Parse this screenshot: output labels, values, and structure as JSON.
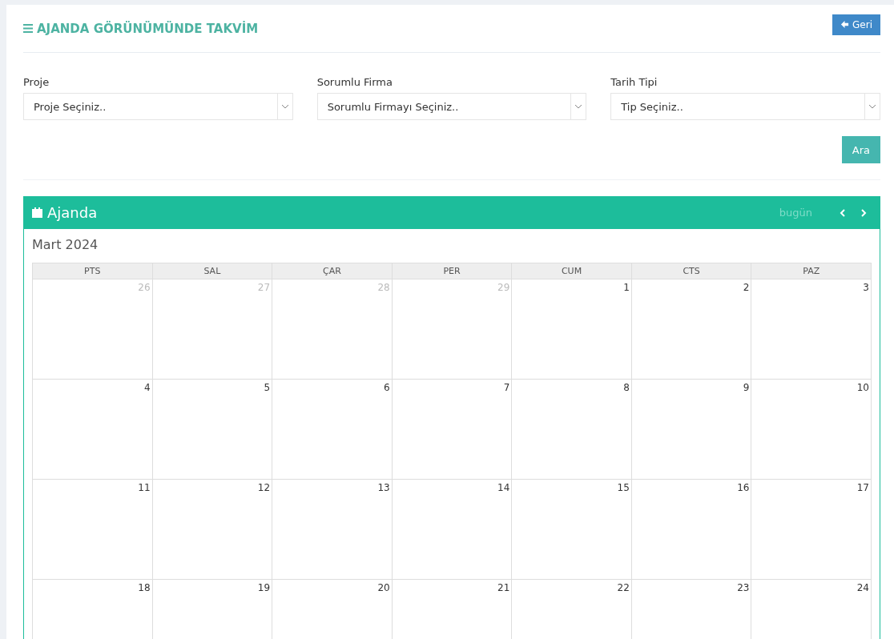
{
  "page_title": "AJANDA GÖRÜNÜMÜNDE TAKVİM",
  "back_button": "Geri",
  "filters": [
    {
      "label": "Proje",
      "placeholder": "Proje Seçiniz.."
    },
    {
      "label": "Sorumlu Firma",
      "placeholder": "Sorumlu Firmayı Seçiniz.."
    },
    {
      "label": "Tarih Tipi",
      "placeholder": "Tip Seçiniz.."
    }
  ],
  "search_button": "Ara",
  "calendar": {
    "panel_title": "Ajanda",
    "today_button": {
      "label": "bugün",
      "disabled": true
    },
    "month": "Mart 2024",
    "weekdays": [
      "PTS",
      "SAL",
      "ÇAR",
      "PER",
      "CUM",
      "CTS",
      "PAZ"
    ],
    "weeks": [
      [
        {
          "day": "26",
          "other_month": true
        },
        {
          "day": "27",
          "other_month": true
        },
        {
          "day": "28",
          "other_month": true
        },
        {
          "day": "29",
          "other_month": true
        },
        {
          "day": "1",
          "other_month": false
        },
        {
          "day": "2",
          "other_month": false
        },
        {
          "day": "3",
          "other_month": false
        }
      ],
      [
        {
          "day": "4",
          "other_month": false
        },
        {
          "day": "5",
          "other_month": false
        },
        {
          "day": "6",
          "other_month": false
        },
        {
          "day": "7",
          "other_month": false
        },
        {
          "day": "8",
          "other_month": false
        },
        {
          "day": "9",
          "other_month": false
        },
        {
          "day": "10",
          "other_month": false
        }
      ],
      [
        {
          "day": "11",
          "other_month": false
        },
        {
          "day": "12",
          "other_month": false
        },
        {
          "day": "13",
          "other_month": false
        },
        {
          "day": "14",
          "other_month": false
        },
        {
          "day": "15",
          "other_month": false
        },
        {
          "day": "16",
          "other_month": false
        },
        {
          "day": "17",
          "other_month": false
        }
      ],
      [
        {
          "day": "18",
          "other_month": false
        },
        {
          "day": "19",
          "other_month": false
        },
        {
          "day": "20",
          "other_month": false
        },
        {
          "day": "21",
          "other_month": false
        },
        {
          "day": "22",
          "other_month": false
        },
        {
          "day": "23",
          "other_month": false
        },
        {
          "day": "24",
          "other_month": false
        }
      ]
    ]
  }
}
